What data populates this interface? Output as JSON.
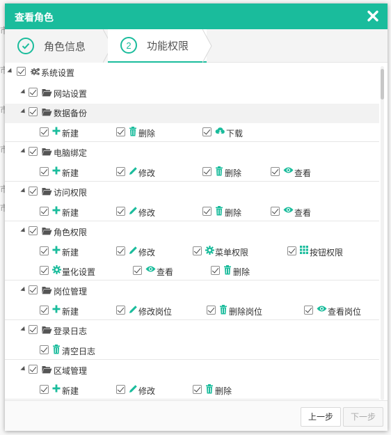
{
  "dialog": {
    "title": "查看角色"
  },
  "steps": [
    {
      "label": "角色信息",
      "done": true
    },
    {
      "number": "2",
      "label": "功能权限",
      "active": true
    }
  ],
  "background_fragments": [
    "市",
    "市",
    "市",
    "市",
    "市",
    "市"
  ],
  "tree": {
    "root": {
      "label": "系统设置",
      "icon": "gears-icon",
      "checked": true
    },
    "groups": [
      {
        "label": "网站设置",
        "checked": true,
        "permissions": []
      },
      {
        "label": "数据备份",
        "checked": true,
        "highlight": true,
        "permissions": [
          {
            "label": "新建",
            "icon": "plus-icon",
            "checked": true
          },
          {
            "label": "删除",
            "icon": "trash-icon",
            "checked": true
          },
          {
            "label": "下载",
            "icon": "cloud-download-icon",
            "checked": true
          }
        ]
      },
      {
        "label": "电脑绑定",
        "checked": true,
        "permissions": [
          {
            "label": "新建",
            "icon": "plus-icon",
            "checked": true
          },
          {
            "label": "修改",
            "icon": "pencil-icon",
            "checked": true
          },
          {
            "label": "删除",
            "icon": "trash-icon",
            "checked": true
          },
          {
            "label": "查看",
            "icon": "eye-icon",
            "checked": true
          }
        ]
      },
      {
        "label": "访问权限",
        "checked": true,
        "permissions": [
          {
            "label": "新建",
            "icon": "plus-icon",
            "checked": true
          },
          {
            "label": "修改",
            "icon": "pencil-icon",
            "checked": true
          },
          {
            "label": "删除",
            "icon": "trash-icon",
            "checked": true
          },
          {
            "label": "查看",
            "icon": "eye-icon",
            "checked": true
          }
        ]
      },
      {
        "label": "角色权限",
        "checked": true,
        "permissions": [
          {
            "label": "新建",
            "icon": "plus-icon",
            "checked": true
          },
          {
            "label": "修改",
            "icon": "pencil-icon",
            "checked": true
          },
          {
            "label": "菜单权限",
            "icon": "gear-icon",
            "checked": true
          },
          {
            "label": "按钮权限",
            "icon": "grid-icon",
            "checked": true
          },
          {
            "label": "量化设置",
            "icon": "gear-icon",
            "checked": true
          },
          {
            "label": "查看",
            "icon": "eye-icon",
            "checked": true
          },
          {
            "label": "删除",
            "icon": "trash-icon",
            "checked": true
          }
        ]
      },
      {
        "label": "岗位管理",
        "checked": true,
        "permissions": [
          {
            "label": "新建",
            "icon": "plus-icon",
            "checked": true
          },
          {
            "label": "修改岗位",
            "icon": "pencil-icon",
            "checked": true
          },
          {
            "label": "删除岗位",
            "icon": "trash-icon",
            "checked": true
          },
          {
            "label": "查看岗位",
            "icon": "eye-icon",
            "checked": true
          }
        ]
      },
      {
        "label": "登录日志",
        "checked": true,
        "permissions": [
          {
            "label": "清空日志",
            "icon": "trash-icon",
            "checked": true
          }
        ]
      },
      {
        "label": "区域管理",
        "checked": true,
        "permissions": [
          {
            "label": "新建",
            "icon": "plus-icon",
            "checked": true
          },
          {
            "label": "修改",
            "icon": "pencil-icon",
            "checked": true
          },
          {
            "label": "删除",
            "icon": "trash-icon",
            "checked": true
          }
        ]
      }
    ]
  },
  "footer": {
    "prev_label": "上一步",
    "next_label": "下一步",
    "next_disabled": true
  },
  "colors": {
    "accent": "#1abc9c"
  }
}
